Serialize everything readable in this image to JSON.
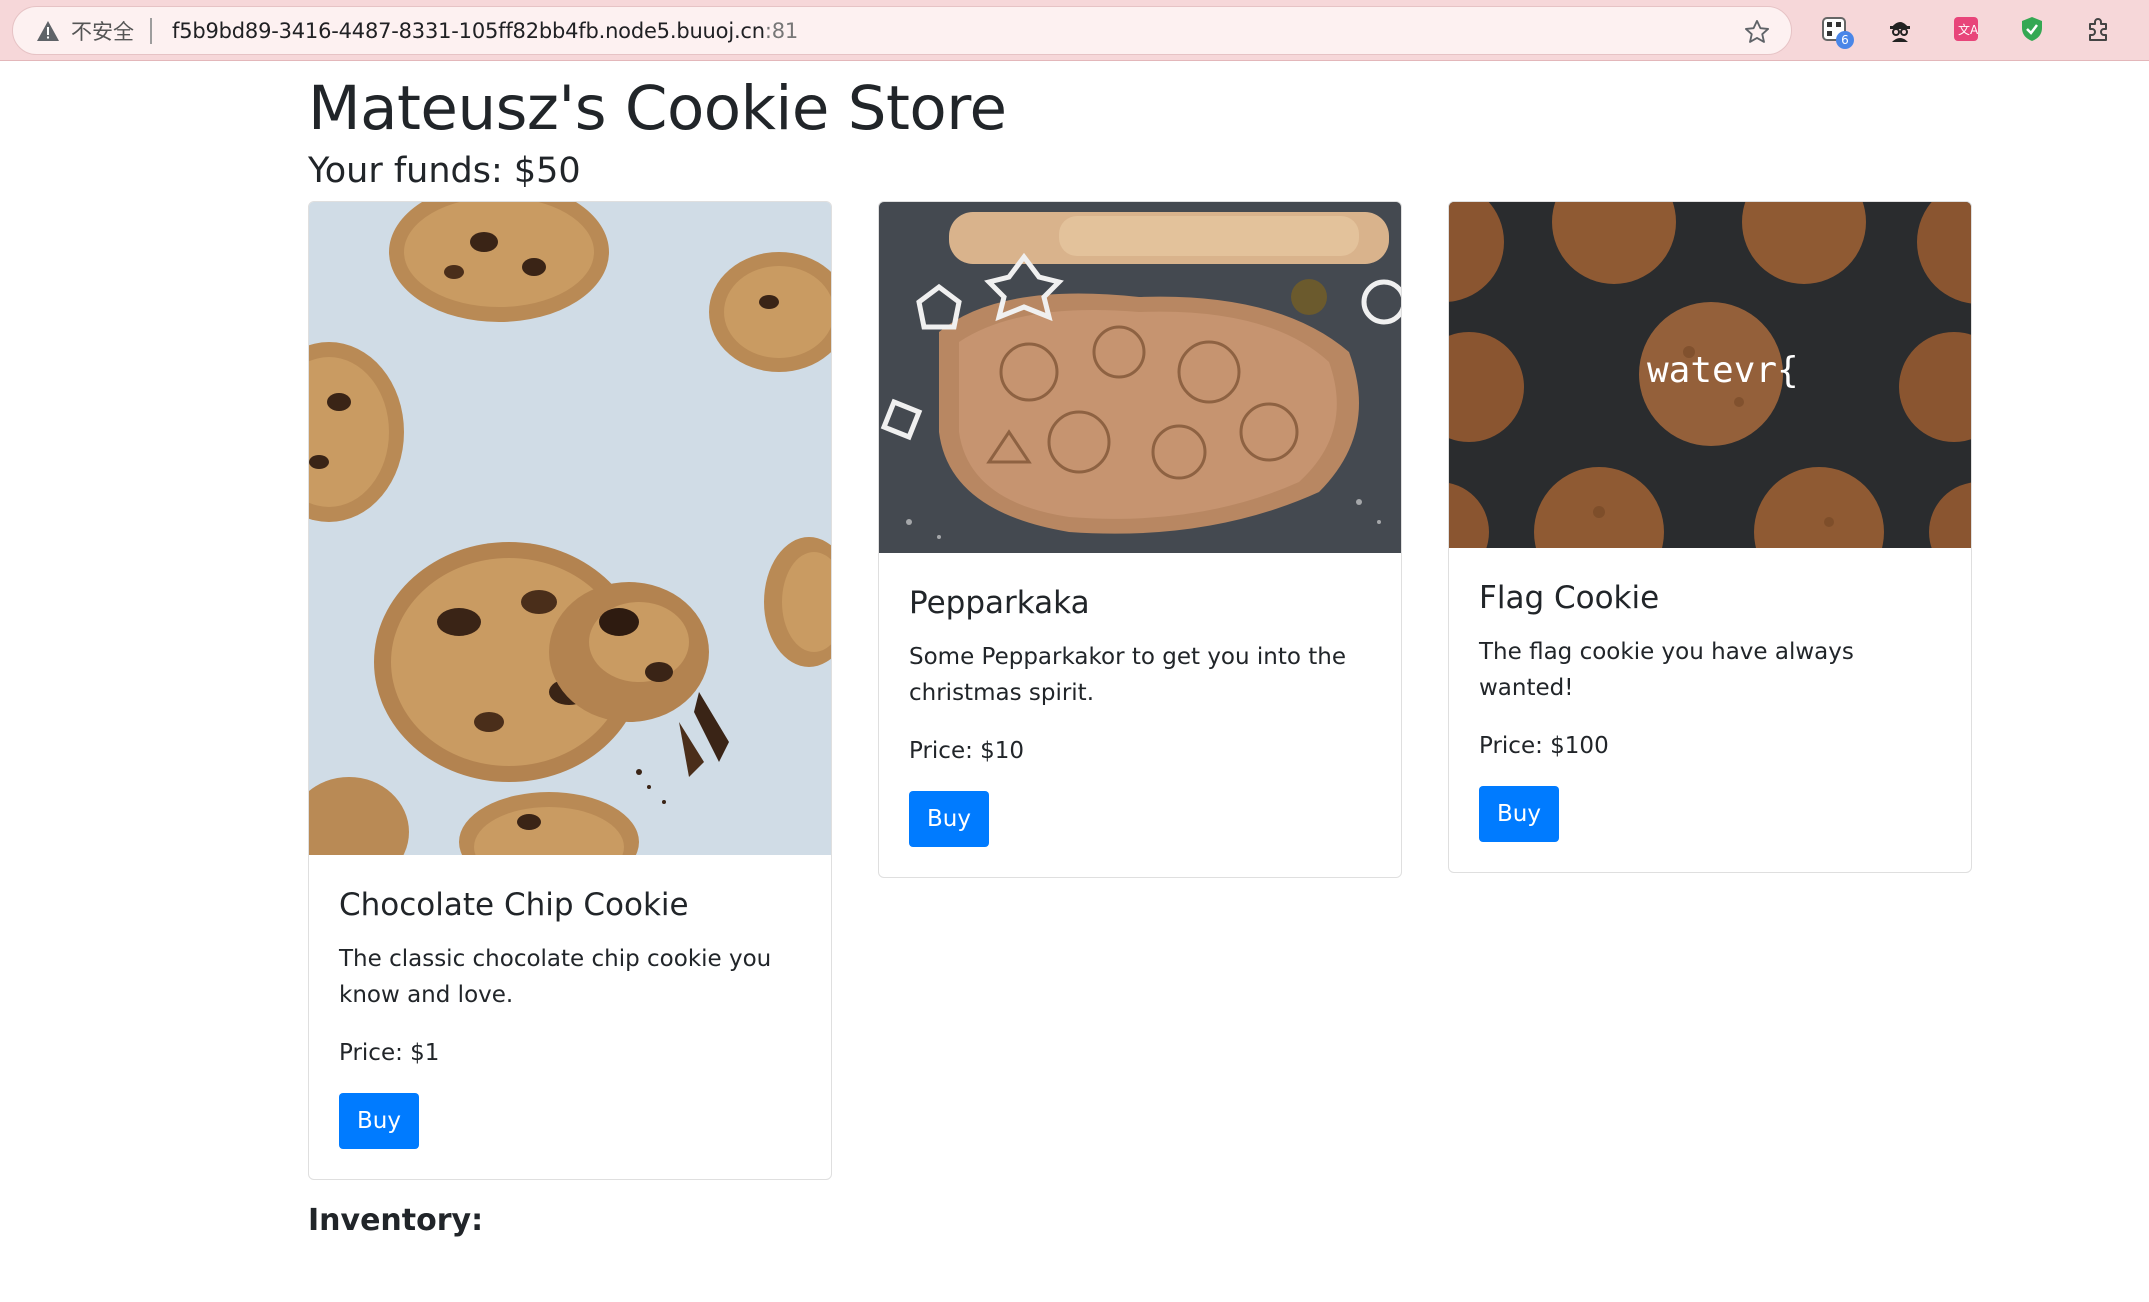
{
  "browser": {
    "security_label": "不安全",
    "url_host": "f5b9bd89-3416-4487-8331-105ff82bb4fb.node5.buuoj.cn",
    "url_port": ":81",
    "extension_badge": "6"
  },
  "page": {
    "title": "Mateusz's Cookie Store",
    "funds": "Your funds: $50",
    "inventory_label": "Inventory:"
  },
  "products": [
    {
      "name": "Chocolate Chip Cookie",
      "description": "The classic chocolate chip cookie you know and love.",
      "price": "Price: $1",
      "buy_label": "Buy"
    },
    {
      "name": "Pepparkaka",
      "description": "Some Pepparkakor to get you into the christmas spirit.",
      "price": "Price: $10",
      "buy_label": "Buy"
    },
    {
      "name": "Flag Cookie",
      "description": "The flag cookie you have always wanted!",
      "price": "Price: $100",
      "buy_label": "Buy",
      "image_text": "watevr{"
    }
  ],
  "colors": {
    "primary_button": "#007bff",
    "chrome_bg": "#f6d7d9"
  }
}
